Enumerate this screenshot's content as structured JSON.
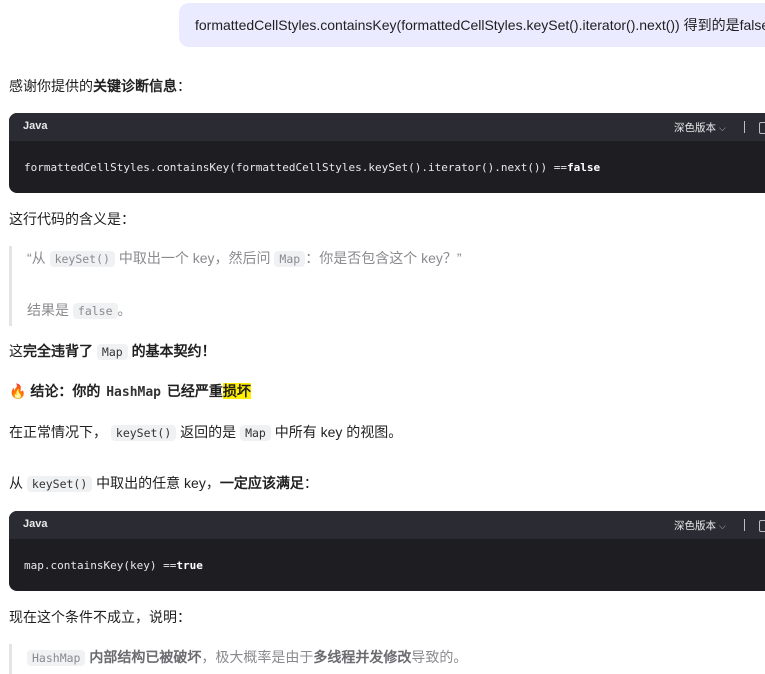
{
  "user_message": "formattedCellStyles.containsKey(formattedCellStyles.keySet().iterator().next()) 得到的是false",
  "intro": {
    "prefix": "感谢你提供的",
    "bold": "关键诊断信息",
    "suffix": "："
  },
  "code1": {
    "lang": "Java",
    "theme_label": "深色版本",
    "code_prefix": "formattedCellStyles.containsKey(formattedCellStyles.keySet().iterator().next()) == ",
    "code_kw": "false"
  },
  "meaning": "这行代码的含义是：",
  "quote1": {
    "line1_a": "“从",
    "line1_code1": "keySet()",
    "line1_b": "中取出一个 key，然后问",
    "line1_code2": "Map",
    "line1_c": "：你是否包含这个 key？”",
    "line2_a": "结果是",
    "line2_code": "false",
    "line2_b": "。"
  },
  "violate": {
    "a": "这",
    "b": "完全违背了",
    "code": "Map",
    "c": "的基本契约",
    "d": "！"
  },
  "conclusion": {
    "emoji": "🔥",
    "a": "结论：你的",
    "code": "HashMap",
    "b": "已经严重",
    "hl": "损坏"
  },
  "normal": {
    "a": "在正常情况下，",
    "code1": "keySet()",
    "b": "返回的是",
    "code2": "Map",
    "c": "中所有 key 的视图。"
  },
  "from": {
    "a": "从",
    "code": "keySet()",
    "b": "中取出的任意 key，",
    "bold": "一定应该满足",
    "c": "："
  },
  "code2": {
    "lang": "Java",
    "theme_label": "深色版本",
    "code_prefix": "map.containsKey(key) == ",
    "code_kw": "true"
  },
  "now": "现在这个条件不成立，说明：",
  "quote2": {
    "code": "HashMap",
    "bold1": "内部结构已被破坏",
    "a": "，极大概率是由于",
    "bold2": "多线程并发修改",
    "b": "导致的。"
  }
}
